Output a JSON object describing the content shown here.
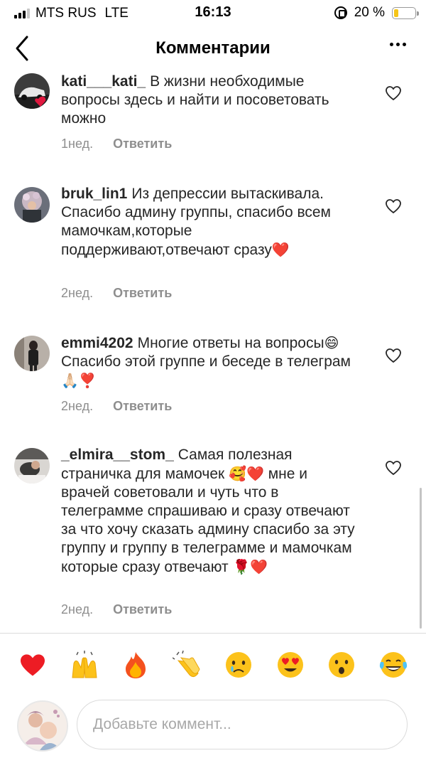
{
  "status_bar": {
    "carrier": "MTS RUS",
    "network": "LTE",
    "time": "16:13",
    "battery_percent": "20 %",
    "battery_level": 0.2
  },
  "header": {
    "title": "Комментарии",
    "back_icon": "chevron-left-icon",
    "more_icon": "more-horizontal-icon"
  },
  "comments": [
    {
      "username": "kati___kati_",
      "text": "В жизни необходимые вопросы здесь и найти и посоветовать можно",
      "emojis": "",
      "time": "1нед.",
      "reply_label": "Ответить"
    },
    {
      "username": "bruk_lin1",
      "text": "Из депрессии вытаскивала. Спасибо админу группы, спасибо всем мамочкам,которые поддерживают,отвечают сразу",
      "emojis": "❤️",
      "time": "2нед.",
      "reply_label": "Ответить"
    },
    {
      "username": "emmi4202",
      "text": "Многие ответы на вопросы",
      "text_b": "Спасибо этой группе и беседе в телеграм",
      "emoji_a": "😄",
      "emoji_b": "🙏🏻❣️",
      "time": "2нед.",
      "reply_label": "Ответить"
    },
    {
      "username": "_elmira__stom_",
      "text": "Самая полезная страничка для мамочек",
      "text_b": "мне и врачей советовали и чуть что в телеграмме спрашиваю и сразу отвечают за что хочу сказать админу спасибо за эту группу и группу в телеграмме и мамочкам которые сразу отвечают",
      "emoji_a": "🥰❤️",
      "emoji_b": "🌹❤️",
      "time": "2нед.",
      "reply_label": "Ответить"
    }
  ],
  "reactions": [
    "❤️",
    "🙌",
    "🔥",
    "👏",
    "😢",
    "😍",
    "😮",
    "😂"
  ],
  "composer": {
    "placeholder": "Добавьте коммент..."
  },
  "colors": {
    "text": "#262626",
    "meta": "#8e8e8e",
    "heart_red": "#ed1c24",
    "battery": "#f5c518"
  }
}
